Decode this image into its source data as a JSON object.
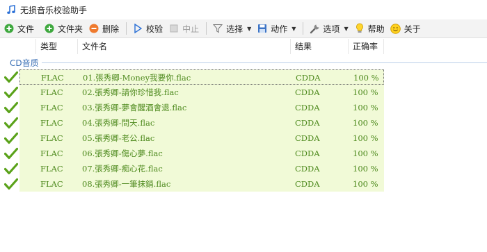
{
  "window": {
    "title": "无损音乐校验助手"
  },
  "toolbar": {
    "file": "文件",
    "folder": "文件夹",
    "delete": "删除",
    "verify": "校验",
    "stop": "中止",
    "select": "选择",
    "action": "动作",
    "options": "选项",
    "help": "帮助",
    "about": "关于"
  },
  "columns": {
    "type": "类型",
    "filename": "文件名",
    "result": "结果",
    "accuracy": "正确率"
  },
  "group": {
    "name": "CD音质"
  },
  "rows": [
    {
      "type": "FLAC",
      "filename": "01.張秀卿-Money我要你.flac",
      "result": "CDDA",
      "accuracy": "100 %"
    },
    {
      "type": "FLAC",
      "filename": "02.張秀卿-請你珍惜我.flac",
      "result": "CDDA",
      "accuracy": "100 %"
    },
    {
      "type": "FLAC",
      "filename": "03.張秀卿-夢會醒酒會退.flac",
      "result": "CDDA",
      "accuracy": "100 %"
    },
    {
      "type": "FLAC",
      "filename": "04.張秀卿-問天.flac",
      "result": "CDDA",
      "accuracy": "100 %"
    },
    {
      "type": "FLAC",
      "filename": "05.張秀卿-老公.flac",
      "result": "CDDA",
      "accuracy": "100 %"
    },
    {
      "type": "FLAC",
      "filename": "06.張秀卿-傷心夢.flac",
      "result": "CDDA",
      "accuracy": "100 %"
    },
    {
      "type": "FLAC",
      "filename": "07.張秀卿-痴心花.flac",
      "result": "CDDA",
      "accuracy": "100 %"
    },
    {
      "type": "FLAC",
      "filename": "08.張秀卿-一筆抹銷.flac",
      "result": "CDDA",
      "accuracy": "100 %"
    }
  ],
  "colors": {
    "accent": "#3a6fb5",
    "row_bg": "#f1fad7",
    "row_text": "#4e8a1e",
    "check": "#5aa21a"
  }
}
